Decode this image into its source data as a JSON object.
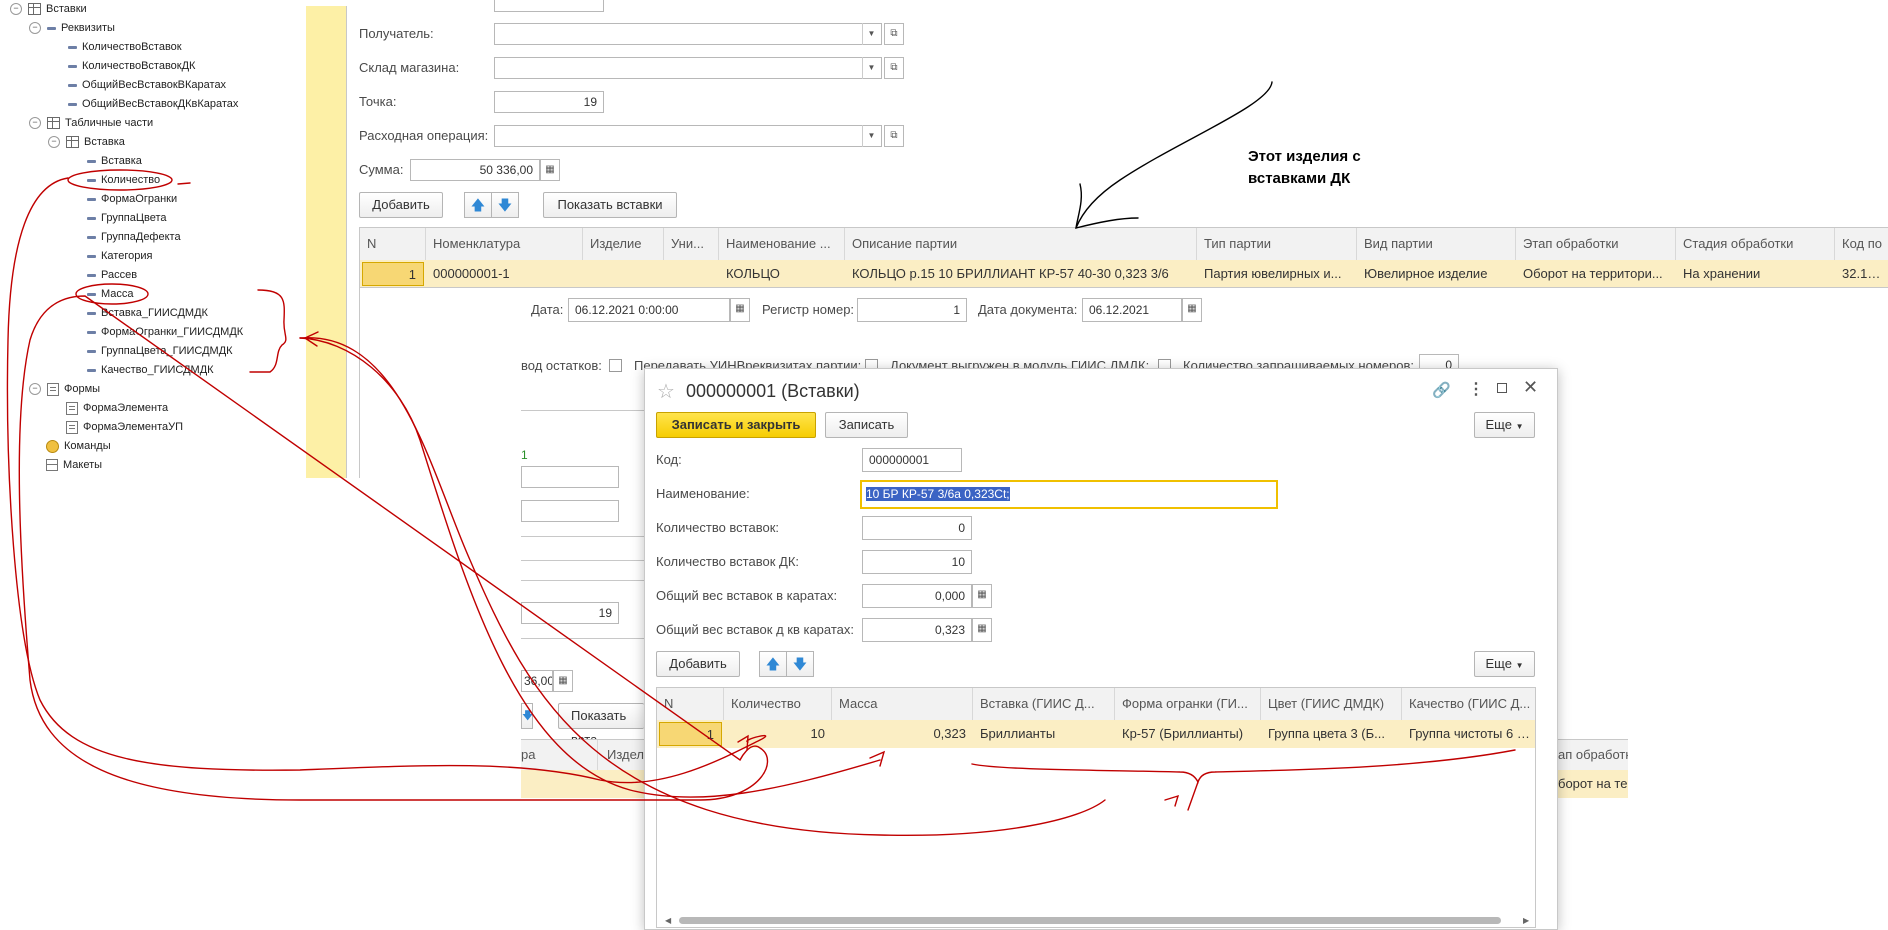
{
  "tree": {
    "root": "Вставки",
    "rekvizity": "Реквизиты",
    "rekv_items": [
      "КоличествоВставок",
      "КоличествоВставокДК",
      "ОбщийВесВставокВКаратах",
      "ОбщийВесВставокДКвКаратах"
    ],
    "tab_parts": "Табличные части",
    "tab_vstavka": "Вставка",
    "tab_items": [
      "Вставка",
      "Количество",
      "ФормаОгранки",
      "ГруппаЦвета",
      "ГруппаДефекта",
      "Категория",
      "Рассев",
      "Масса",
      "Вставка_ГИИСДМДК",
      "ФормаОгранки_ГИИСДМДК",
      "ГруппаЦвета_ГИИСДМДК",
      "Качество_ГИИСДМДК"
    ],
    "forms": "Формы",
    "form_items": [
      "ФормаЭлемента",
      "ФормаЭлементаУП"
    ],
    "commands": "Команды",
    "makety": "Макеты"
  },
  "bg_form": {
    "poluchatel_label": "Получатель:",
    "sklad_label": "Склад магазина:",
    "tochka_label": "Точка:",
    "tochka_value": "19",
    "rashod_label": "Расходная операция:",
    "summa_label": "Сумма:",
    "summa_value": "50 336,00",
    "add_label": "Добавить",
    "show_label": "Показать вставки",
    "columns": [
      "N",
      "Номенклатура",
      "Изделие",
      "Уни...",
      "Наименование ...",
      "Описание партии",
      "Тип партии",
      "Вид партии",
      "Этап обработки",
      "Стадия обработки",
      "Код по"
    ],
    "row": [
      "1",
      "000000001-1",
      "",
      "",
      "КОЛЬЦО",
      "КОЛЬЦО р.15 10 БРИЛЛИАНТ КР-57 40-30 0,323 3/6",
      "Партия ювелирных и...",
      "Ювелирное изделие",
      "Оборот на территори...",
      "На хранении",
      "32.12.1"
    ],
    "date_label": "Дата:",
    "date_value": "06.12.2021  0:00:00",
    "reg_label": "Регистр номер:",
    "reg_value": "1",
    "docdate_label": "Дата документа:",
    "docdate_value": "06.12.2021",
    "cb1": "вод остатков:",
    "cb2": "Передавать УИНВреквизитах партии:",
    "cb3": "Документ выгружен в модуль ГИИС ДМДК:",
    "cb4": "Количество запрашиваемых номеров:",
    "cb4_value": "0",
    "peek_19": "19",
    "peek_sum": "36,00",
    "peek_show": "Показать вста",
    "peek_col1": "ра",
    "peek_col2": "Издел",
    "peek_col3": "ап обработк",
    "peek_val3": "борот на терр",
    "peek_green": "1"
  },
  "annotation": {
    "line1": "Этот изделия с",
    "line2": "вставками ДК"
  },
  "dialog": {
    "title": "000000001 (Вставки)",
    "save_close": "Записать и закрыть",
    "save": "Записать",
    "more": "Еще",
    "kod_label": "Код:",
    "kod_value": "000000001",
    "naim_label": "Наименование:",
    "naim_value": "10 БР КР-57 3/6а 0,323Ct;",
    "qty_label": "Количество вставок:",
    "qty_value": "0",
    "qtydk_label": "Количество вставок ДК:",
    "qtydk_value": "10",
    "weight_label": "Общий вес вставок в каратах:",
    "weight_value": "0,000",
    "weightdk_label": "Общий вес вставок д кв каратах:",
    "weightdk_value": "0,323",
    "add_label": "Добавить",
    "more2": "Еще",
    "columns": [
      "N",
      "Количество",
      "Масса",
      "Вставка (ГИИС Д...",
      "Форма огранки (ГИ...",
      "Цвет (ГИИС ДМДК)",
      "Качество (ГИИС Д..."
    ],
    "row": [
      "1",
      "10",
      "0,323",
      "Бриллианты",
      "Кр-57 (Бриллианты)",
      "Группа цвета 3 (Б...",
      "Группа чистоты 6 (..."
    ]
  },
  "colors": {
    "accent_yellow": "#f6cd02",
    "row_highlight": "#fbeec4",
    "selection_blue": "#3b63c4",
    "pen_red": "#c00000"
  }
}
